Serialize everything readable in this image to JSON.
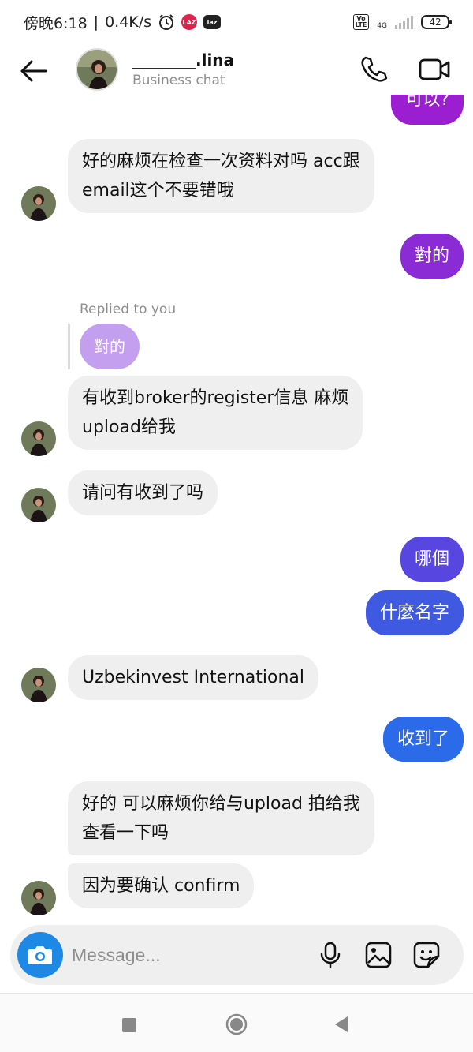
{
  "status_bar": {
    "time": "傍晚6:18",
    "speed": "0.4K/s",
    "network": "4G",
    "battery": "42",
    "lazada_icon": "LAZ",
    "laz_icon": "laz",
    "volte_badge_top": "Vo",
    "volte_badge_bottom": "LTE"
  },
  "header": {
    "name": "________.lina",
    "subtitle": "Business chat",
    "back_icon": "arrow-left-icon",
    "call_icon": "phone-icon",
    "video_icon": "video-icon"
  },
  "messages": [
    {
      "side": "out",
      "text": "可以?",
      "color": "#9b1fd1"
    },
    {
      "side": "in",
      "lines": [
        "好的麻烦在检查一次资料对吗 acc跟",
        "email这个不要错哦"
      ]
    },
    {
      "side": "out",
      "text": "對的",
      "color": "#8a2bd6"
    },
    {
      "side": "in",
      "replied_label": "Replied to you",
      "quote": "對的",
      "lines": [
        "有收到broker的register信息 麻烦",
        "upload给我"
      ]
    },
    {
      "side": "in",
      "text": "请问有收到了吗"
    },
    {
      "side": "out",
      "text": "哪個",
      "color": "#5846e0"
    },
    {
      "side": "out",
      "text": "什麼名字",
      "color": "#3f5ae0"
    },
    {
      "side": "in",
      "text": "Uzbekinvest International"
    },
    {
      "side": "out",
      "text": "收到了",
      "color": "#2b6ae8"
    },
    {
      "side": "in",
      "lines": [
        "好的 可以麻烦你给与upload 拍给我",
        "查看一下吗"
      ]
    },
    {
      "side": "in",
      "text": "因为要确认 confirm"
    }
  ],
  "composer": {
    "placeholder": "Message...",
    "camera_icon": "camera-icon",
    "mic_icon": "microphone-icon",
    "gallery_icon": "gallery-icon",
    "sticker_icon": "sticker-icon"
  },
  "navbar": {
    "recent_icon": "square-icon",
    "home_icon": "circle-icon",
    "back_icon": "triangle-back-icon"
  }
}
